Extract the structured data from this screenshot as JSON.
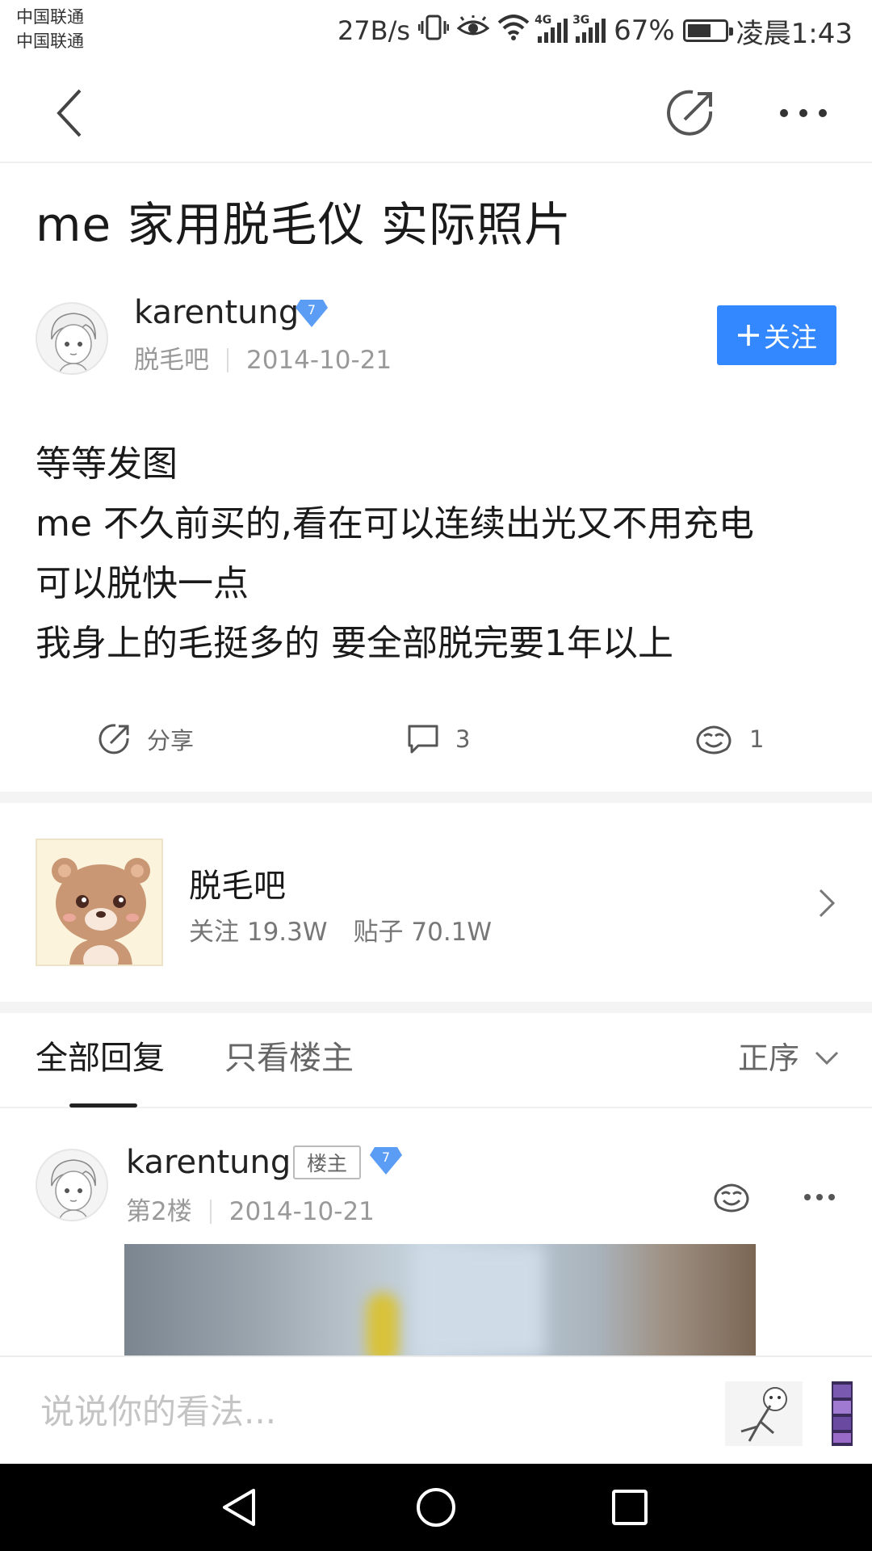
{
  "status_bar": {
    "carrier_1": "中国联通",
    "carrier_2": "中国联通",
    "net_speed": "27B/s",
    "sig1_label": "4G",
    "sig2_label": "3G",
    "battery": "67%",
    "time": "凌晨1:43"
  },
  "nav": {
    "back_icon": "chevron-left-icon",
    "share_icon": "share-icon",
    "more_icon": "more-dots-icon"
  },
  "post": {
    "title": "me 家用脱毛仪 实际照片",
    "author": {
      "name": "karentung",
      "level": "7",
      "forum": "脱毛吧",
      "date": "2014-10-21",
      "follow_label": "关注"
    },
    "body_lines": [
      "等等发图",
      "me 不久前买的,看在可以连续出光又不用充电",
      "可以脱快一点",
      "我身上的毛挺多的 要全部脱完要1年以上"
    ],
    "actions": {
      "share_label": "分享",
      "comment_count": "3",
      "like_count": "1"
    }
  },
  "forum_card": {
    "name": "脱毛吧",
    "followers": "关注 19.3W",
    "posts": "贴子 70.1W"
  },
  "tabs": {
    "all_replies": "全部回复",
    "op_only": "只看楼主",
    "sort": "正序"
  },
  "reply": {
    "name": "karentung",
    "op_tag": "楼主",
    "level": "7",
    "floor": "第2楼",
    "date": "2014-10-21"
  },
  "bottom": {
    "comment_placeholder": "说说你的看法..."
  },
  "colors": {
    "accent": "#3388ff",
    "level_badge": "#5b9cf5",
    "divider": "#f4f4f4"
  }
}
